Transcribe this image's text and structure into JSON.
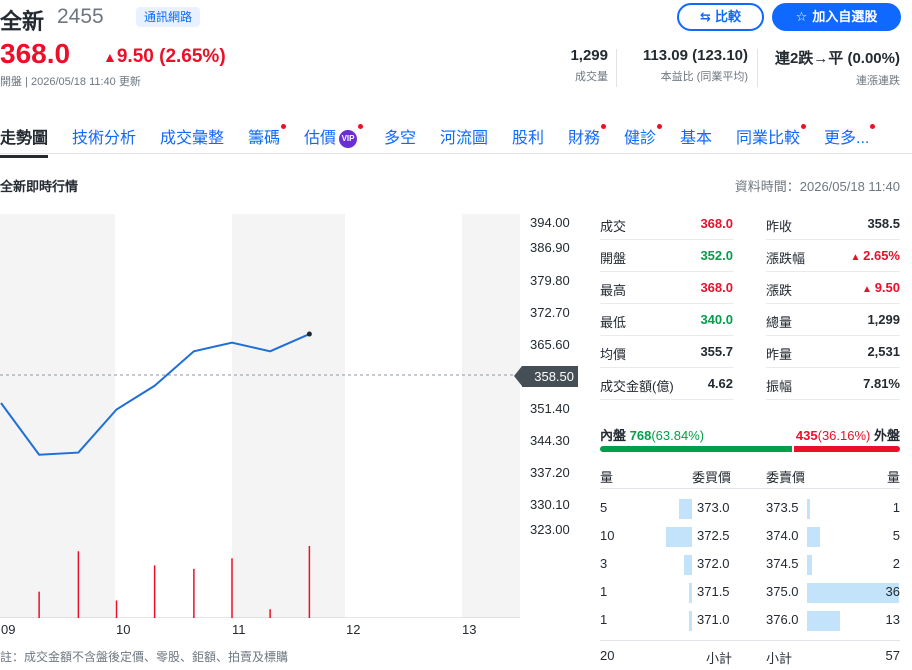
{
  "header": {
    "name": "全新",
    "code": "2455",
    "tag": "通訊網路",
    "compare_label": "比較",
    "add_watchlist_label": "加入自選股",
    "price": "368.0",
    "change": "9.50",
    "change_pct": "(2.65%)",
    "status_line": "開盤 | 2026/05/18 11:40 更新",
    "stats": [
      {
        "value": "1,299",
        "label": "成交量"
      },
      {
        "value": "113.09 (123.10)",
        "label": "本益比 (同業平均)"
      },
      {
        "value": "連2跌→平 (0.00%)",
        "label": "連漲連跌"
      }
    ]
  },
  "tabs": [
    {
      "label": "走勢圖",
      "active": true,
      "dot": false
    },
    {
      "label": "技術分析",
      "dot": false
    },
    {
      "label": "成交彙整",
      "dot": false
    },
    {
      "label": "籌碼",
      "dot": true
    },
    {
      "label": "估價",
      "dot": true,
      "vip": "VIP"
    },
    {
      "label": "多空",
      "dot": false
    },
    {
      "label": "河流圖",
      "dot": false
    },
    {
      "label": "股利",
      "dot": false
    },
    {
      "label": "財務",
      "dot": true
    },
    {
      "label": "健診",
      "dot": true
    },
    {
      "label": "基本",
      "dot": false
    },
    {
      "label": "同業比較",
      "dot": true
    },
    {
      "label": "更多...",
      "dot": true
    }
  ],
  "section": {
    "title": "全新即時行情",
    "data_time": "資料時間：2026/05/18 11:40"
  },
  "chart_data": {
    "type": "line",
    "y_ticks": [
      "394.00",
      "386.90",
      "379.80",
      "372.70",
      "365.60",
      "358.50",
      "351.40",
      "344.30",
      "337.20",
      "330.10",
      "323.00"
    ],
    "x_ticks": [
      "09",
      "10",
      "11",
      "12",
      "13"
    ],
    "reference_label": "358.50",
    "reference": 358.5,
    "ylim": [
      323.0,
      394.0
    ],
    "x": [
      9.0,
      9.33,
      9.67,
      10.0,
      10.33,
      10.67,
      11.0,
      11.33,
      11.67
    ],
    "price": [
      352.0,
      340.0,
      340.5,
      350.5,
      356.0,
      364.0,
      366.0,
      364.0,
      368.0
    ],
    "volume_x": [
      9.33,
      9.67,
      10.0,
      10.33,
      10.67,
      11.0,
      11.33,
      11.67
    ],
    "volume": [
      150,
      380,
      100,
      300,
      280,
      340,
      50,
      410
    ]
  },
  "quote": {
    "left": [
      {
        "label": "成交",
        "value": "368.0",
        "color": "up"
      },
      {
        "label": "開盤",
        "value": "352.0",
        "color": "green"
      },
      {
        "label": "最高",
        "value": "368.0",
        "color": "up"
      },
      {
        "label": "最低",
        "value": "340.0",
        "color": "green"
      },
      {
        "label": "均價",
        "value": "355.7",
        "color": "plain"
      },
      {
        "label": "成交金額(億)",
        "value": "4.62",
        "color": "plain"
      }
    ],
    "right": [
      {
        "label": "昨收",
        "value": "358.5",
        "color": "plain"
      },
      {
        "label": "漲跌幅",
        "value": "2.65%",
        "color": "up",
        "arrow": true
      },
      {
        "label": "漲跌",
        "value": "9.50",
        "color": "up",
        "arrow": true
      },
      {
        "label": "總量",
        "value": "1,299",
        "color": "plain"
      },
      {
        "label": "昨量",
        "value": "2,531",
        "color": "plain"
      },
      {
        "label": "振幅",
        "value": "7.81%",
        "color": "plain"
      }
    ]
  },
  "inner_outer": {
    "inner_label": "內盤",
    "inner_value": "768",
    "inner_pct": "(63.84%)",
    "outer_value": "435",
    "outer_pct": "(36.16%)",
    "outer_label": "外盤",
    "inner_fraction": 0.6384
  },
  "order_book": {
    "headers": {
      "bid_qty": "量",
      "bid_price": "委買價",
      "ask_price": "委賣價",
      "ask_qty": "量"
    },
    "rows": [
      {
        "bid_qty": "5",
        "bid_price": "373.0",
        "ask_price": "373.5",
        "ask_qty": "1"
      },
      {
        "bid_qty": "10",
        "bid_price": "372.5",
        "ask_price": "374.0",
        "ask_qty": "5"
      },
      {
        "bid_qty": "3",
        "bid_price": "372.0",
        "ask_price": "374.5",
        "ask_qty": "2"
      },
      {
        "bid_qty": "1",
        "bid_price": "371.5",
        "ask_price": "375.0",
        "ask_qty": "36"
      },
      {
        "bid_qty": "1",
        "bid_price": "371.0",
        "ask_price": "376.0",
        "ask_qty": "13"
      }
    ],
    "footer": {
      "bid_total": "20",
      "bid_label": "小計",
      "ask_label": "小計",
      "ask_total": "57"
    }
  },
  "note": "註：成交金額不含盤後定價、零股、鉅額、拍賣及標購"
}
